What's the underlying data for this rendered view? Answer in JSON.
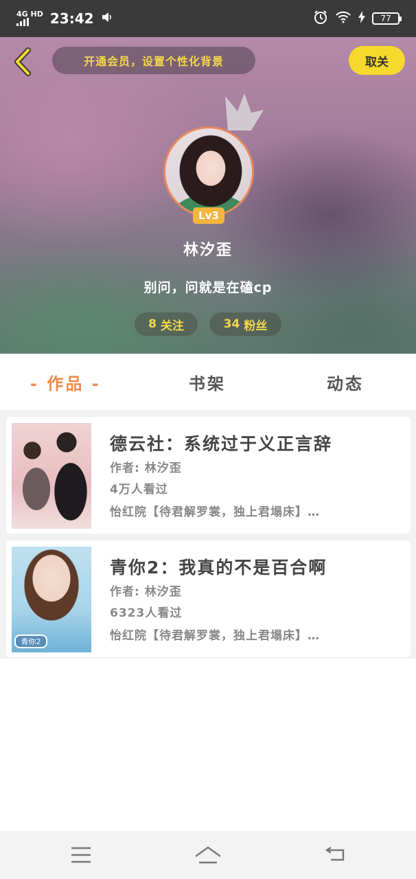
{
  "status_bar": {
    "network": "4G HD",
    "time": "23:42",
    "battery": "77"
  },
  "header": {
    "vip_banner": "开通会员，设置个性化背景",
    "unfollow_label": "取关",
    "level": "Lv3",
    "user_name": "林汐歪",
    "bio": "别问，问就是在磕cp",
    "following_count": "8",
    "following_label": "关注",
    "fans_count": "34",
    "fans_label": "粉丝"
  },
  "tabs": [
    {
      "label": "- 作品 -",
      "active": true
    },
    {
      "label": "书架",
      "active": false
    },
    {
      "label": "动态",
      "active": false
    }
  ],
  "works": [
    {
      "title": "德云社：系统过于义正言辞",
      "author": "作者: 林汐歪",
      "views": "4万人看过",
      "tags": "怡红院【待君解罗裳，独上君塌床】…"
    },
    {
      "title": "青你2：我真的不是百合啊",
      "author": "作者: 林汐歪",
      "views": "6323人看过",
      "tags": "怡红院【待君解罗裳，独上君塌床】…",
      "cover_tag": "青你2"
    }
  ],
  "colors": {
    "accent": "#f08a47",
    "yellow": "#f6d92c",
    "badge": "#f2b53e"
  }
}
